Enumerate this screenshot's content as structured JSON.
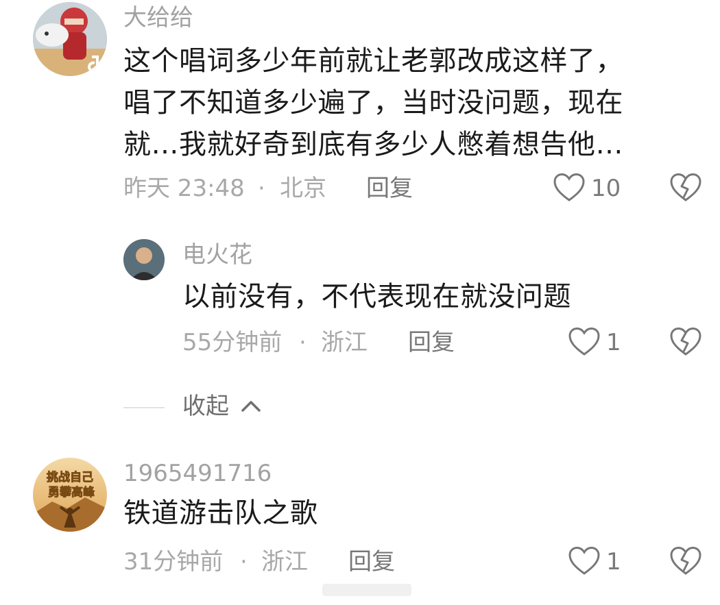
{
  "comments": [
    {
      "username": "大给给",
      "lines": [
        "这个唱词多少年前就让老郭改成这样了，",
        "唱了不知道多少遍了，当时没问题，现在",
        "就…我就好奇到底有多少人憋着想告他…"
      ],
      "time": "昨天 23:48",
      "sep": "·",
      "location": "北京",
      "reply_label": "回复",
      "likes": "10"
    },
    {
      "username": "电火花",
      "lines": [
        "以前没有，不代表现在就没问题"
      ],
      "time": "55分钟前",
      "sep": "·",
      "location": "浙江",
      "reply_label": "回复",
      "likes": "1"
    },
    {
      "username": "1965491716",
      "lines": [
        "铁道游击队之歌"
      ],
      "time": "31分钟前",
      "sep": "·",
      "location": "浙江",
      "reply_label": "回复",
      "likes": "1"
    }
  ],
  "collapse": {
    "label": "收起"
  },
  "avatar3": {
    "line1": "挑战自己",
    "line2": "勇攀高峰"
  }
}
